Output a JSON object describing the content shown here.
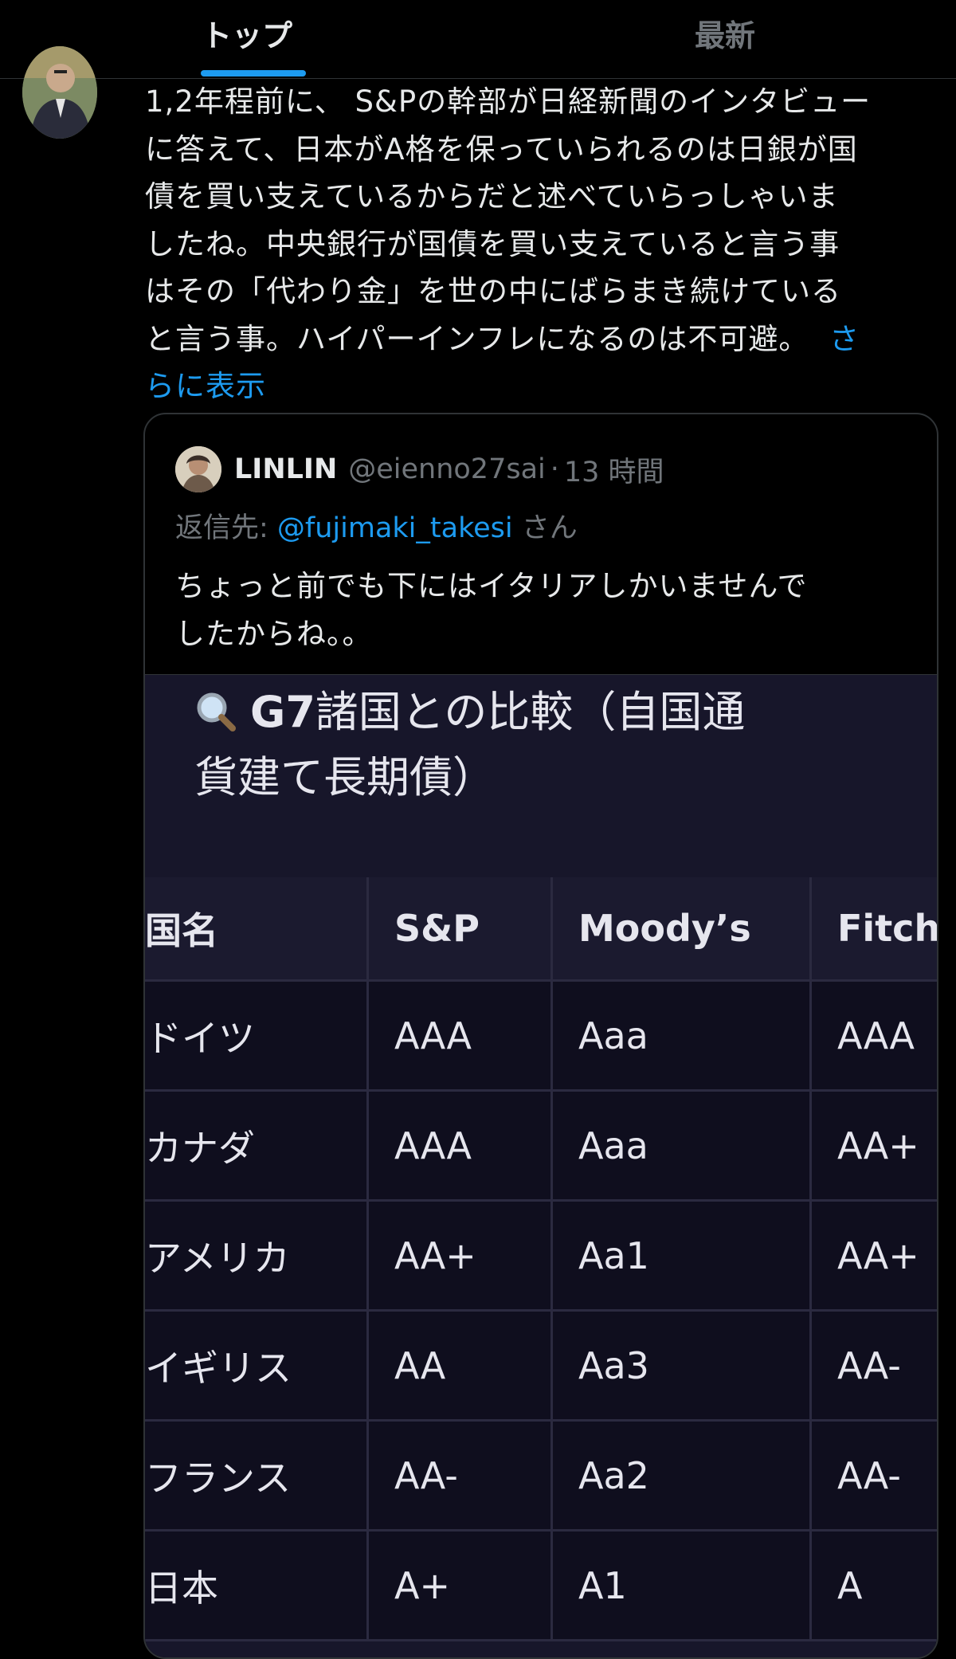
{
  "tabs": [
    {
      "label": "トップ",
      "active": true
    },
    {
      "label": "最新",
      "active": false
    }
  ],
  "tweet": {
    "lines": [
      "1,2年程前に、 S&Pの幹部が日経新聞のインタビュー",
      "に答えて、日本がA格を保っていられるのは日銀が国",
      "債を買い支えているからだと述べていらっしゃいま",
      "したね。中央銀行が国債を買い支えていると言う事",
      "はその「代わり金」を世の中にばらまき続けている",
      "と言う事。ハイパーインフレになるのは不可避。"
    ],
    "show_more_part1": "さ",
    "show_more_part2": "らに表示"
  },
  "quote": {
    "name": "LINLIN",
    "handle": "@eienno27sai",
    "separator": "·",
    "time": "13 時間",
    "reply_prefix": "返信先: ",
    "reply_mention": "@fujimaki_takesi",
    "reply_suffix": " さん",
    "text_lines": [
      "ちょっと前でも下にはイタリアしかいませんで",
      "したからね。。"
    ],
    "image": {
      "title_line1_bold": "G7",
      "title_line1_rest": "諸国との比較（自国通",
      "title_line2": "貨建て長期債）",
      "headers": [
        "国名",
        "S&P",
        "Moody’s",
        "Fitch"
      ],
      "rows": [
        [
          "ドイツ",
          "AAA",
          "Aaa",
          "AAA"
        ],
        [
          "カナダ",
          "AAA",
          "Aaa",
          "AA+"
        ],
        [
          "アメリカ",
          "AA+",
          "Aa1",
          "AA+"
        ],
        [
          "イギリス",
          "AA",
          "Aa3",
          "AA-"
        ],
        [
          "フランス",
          "AA-",
          "Aa2",
          "AA-"
        ],
        [
          "日本",
          "A+",
          "A1",
          "A"
        ]
      ]
    }
  },
  "colors": {
    "background": "#000000",
    "text": "#e7e9ea",
    "muted": "#71767b",
    "accent": "#1d9bf0",
    "table_bg": "#17162a"
  }
}
